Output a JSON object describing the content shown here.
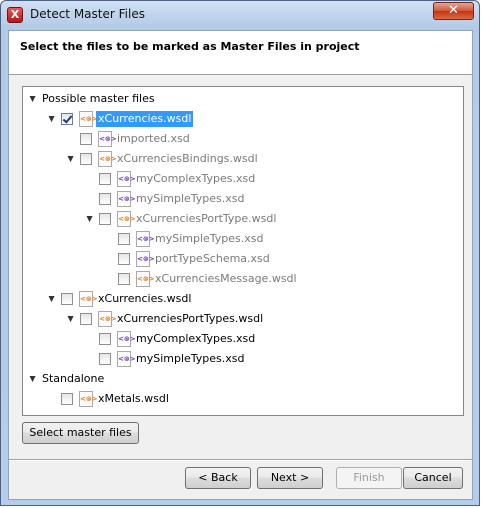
{
  "window": {
    "title": "Detect Master Files",
    "close_symbol": "✕"
  },
  "header": {
    "title": "Select the files to be marked as Master Files in project"
  },
  "tree": [
    {
      "kind": "group",
      "text": "Possible master files",
      "twisty": "▲"
    },
    {
      "kind": "file",
      "text": "xCurrencies.wsdl",
      "type": "wsdl",
      "checked": true,
      "selected": true,
      "dim": false,
      "twisty": "▲"
    },
    {
      "kind": "file",
      "text": "imported.xsd",
      "type": "xsd",
      "checked": false,
      "selected": false,
      "dim": true,
      "twisty": ""
    },
    {
      "kind": "file",
      "text": "xCurrenciesBindings.wsdl",
      "type": "wsdl",
      "checked": false,
      "selected": false,
      "dim": true,
      "twisty": "▲"
    },
    {
      "kind": "file",
      "text": "myComplexTypes.xsd",
      "type": "xsd",
      "checked": false,
      "selected": false,
      "dim": true,
      "twisty": ""
    },
    {
      "kind": "file",
      "text": "mySimpleTypes.xsd",
      "type": "xsd",
      "checked": false,
      "selected": false,
      "dim": true,
      "twisty": ""
    },
    {
      "kind": "file",
      "text": "xCurrenciesPortType.wsdl",
      "type": "wsdl",
      "checked": false,
      "selected": false,
      "dim": true,
      "twisty": "▲"
    },
    {
      "kind": "file",
      "text": "mySimpleTypes.xsd",
      "type": "xsd",
      "checked": false,
      "selected": false,
      "dim": true,
      "twisty": ""
    },
    {
      "kind": "file",
      "text": "portTypeSchema.xsd",
      "type": "xsd",
      "checked": false,
      "selected": false,
      "dim": true,
      "twisty": ""
    },
    {
      "kind": "file",
      "text": "xCurrenciesMessage.wsdl",
      "type": "wsdl",
      "checked": false,
      "selected": false,
      "dim": true,
      "twisty": ""
    },
    {
      "kind": "file",
      "text": "xCurrencies.wsdl",
      "type": "wsdl",
      "checked": false,
      "selected": false,
      "dim": false,
      "twisty": "▲"
    },
    {
      "kind": "file",
      "text": "xCurrenciesPortTypes.wsdl",
      "type": "wsdl",
      "checked": false,
      "selected": false,
      "dim": false,
      "twisty": "▲"
    },
    {
      "kind": "file",
      "text": "myComplexTypes.xsd",
      "type": "xsd",
      "checked": false,
      "selected": false,
      "dim": false,
      "twisty": ""
    },
    {
      "kind": "file",
      "text": "mySimpleTypes.xsd",
      "type": "xsd",
      "checked": false,
      "selected": false,
      "dim": false,
      "twisty": ""
    },
    {
      "kind": "group",
      "text": "Standalone",
      "twisty": "▲"
    },
    {
      "kind": "file",
      "text": "xMetals.wsdl",
      "type": "wsdl",
      "checked": false,
      "selected": false,
      "dim": false,
      "twisty": ""
    }
  ],
  "file_icon_glyph": "<⊗>",
  "buttons": {
    "select_master": "Select master files",
    "back": "< Back",
    "next": "Next >",
    "finish": "Finish",
    "cancel": "Cancel"
  },
  "colors": {
    "selection": "#3399ff",
    "wsdl_icon": "#e07a12",
    "xsd_icon": "#6a33b5"
  }
}
